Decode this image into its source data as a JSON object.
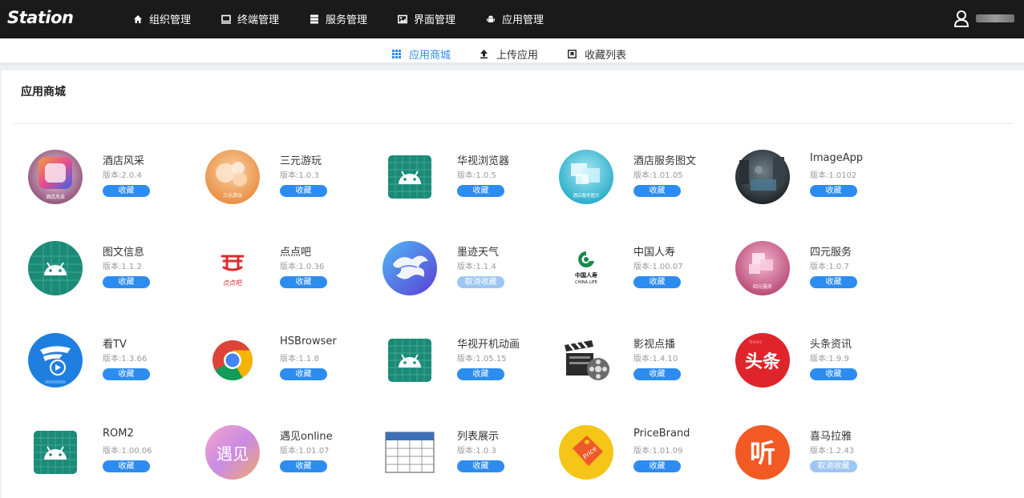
{
  "brand": "Station",
  "nav": [
    {
      "label": "组织管理",
      "icon": "home-icon"
    },
    {
      "label": "终端管理",
      "icon": "monitor-icon"
    },
    {
      "label": "服务管理",
      "icon": "server-icon"
    },
    {
      "label": "界面管理",
      "icon": "image-icon"
    },
    {
      "label": "应用管理",
      "icon": "android-icon"
    }
  ],
  "user": {
    "icon": "user-icon"
  },
  "subnav": [
    {
      "label": "应用商城",
      "icon": "grid-icon",
      "active": true
    },
    {
      "label": "上传应用",
      "icon": "upload-icon",
      "active": false
    },
    {
      "label": "收藏列表",
      "icon": "bookmark-icon",
      "active": false
    }
  ],
  "page": {
    "title": "应用商城"
  },
  "apps": [
    {
      "name": "酒店风采",
      "version": "版本:2.0.4",
      "action": "收藏",
      "icon": "hotel-style-icon"
    },
    {
      "name": "三元游玩",
      "version": "版本:1.0.3",
      "action": "收藏",
      "icon": "sanyuan-play-icon"
    },
    {
      "name": "华视浏览器",
      "version": "版本:1.0.5",
      "action": "收藏",
      "icon": "android-app-icon"
    },
    {
      "name": "酒店服务图文",
      "version": "版本:1.01.05",
      "action": "收藏",
      "icon": "hotel-service-icon"
    },
    {
      "name": "ImageApp",
      "version": "版本:1.0102",
      "action": "收藏",
      "icon": "photo-app-icon"
    },
    {
      "name": "图文信息",
      "version": "版本:1.1.2",
      "action": "收藏",
      "icon": "android-app-icon"
    },
    {
      "name": "点点吧",
      "version": "版本:1.0.36",
      "action": "收藏",
      "icon": "diandianba-icon"
    },
    {
      "name": "墨迹天气",
      "version": "版本:1.1.4",
      "action": "取消收藏",
      "icon": "weather-icon"
    },
    {
      "name": "中国人寿",
      "version": "版本:1.00.07",
      "action": "收藏",
      "icon": "china-life-icon"
    },
    {
      "name": "四元服务",
      "version": "版本:1.0.7",
      "action": "收藏",
      "icon": "four-service-icon"
    },
    {
      "name": "看TV",
      "version": "版本:1.3.66",
      "action": "收藏",
      "icon": "tv-icon"
    },
    {
      "name": "HSBrowser",
      "version": "版本:1.1.8",
      "action": "收藏",
      "icon": "chrome-icon"
    },
    {
      "name": "华视开机动画",
      "version": "版本:1.05.15",
      "action": "收藏",
      "icon": "android-app-icon"
    },
    {
      "name": "影视点播",
      "version": "版本:1.4.10",
      "action": "收藏",
      "icon": "film-icon"
    },
    {
      "name": "头条资讯",
      "version": "版本:1.9.9",
      "action": "收藏",
      "icon": "toutiao-icon"
    },
    {
      "name": "ROM2",
      "version": "版本:1.00.06",
      "action": "收藏",
      "icon": "android-app-icon"
    },
    {
      "name": "遇见online",
      "version": "版本:1.01.07",
      "action": "收藏",
      "icon": "yujian-icon"
    },
    {
      "name": "列表展示",
      "version": "版本:1.0.3",
      "action": "收藏",
      "icon": "table-icon"
    },
    {
      "name": "PriceBrand",
      "version": "版本:1.01.09",
      "action": "收藏",
      "icon": "price-tag-icon"
    },
    {
      "name": "喜马拉雅",
      "version": "版本:1.2.43",
      "action": "取消收藏",
      "icon": "ximalaya-icon"
    }
  ],
  "icon_text": {
    "hotel_style": "酒店风采",
    "sanyuan": "三元游玩",
    "hotel_service": "酒店服务图文",
    "diandian_cn": "点点吧",
    "china_life_cn": "中国人寿",
    "china_life_en": "CHINA LIFE",
    "four_service": "四元服务",
    "toutiao": "头条",
    "toutiao_small": "News",
    "yujian": "遇见",
    "price": "Price",
    "ximalaya": "听"
  },
  "colors": {
    "accent": "#2d8cf0",
    "cancel": "#9ec6f3",
    "topbar": "#1a1a1a"
  }
}
